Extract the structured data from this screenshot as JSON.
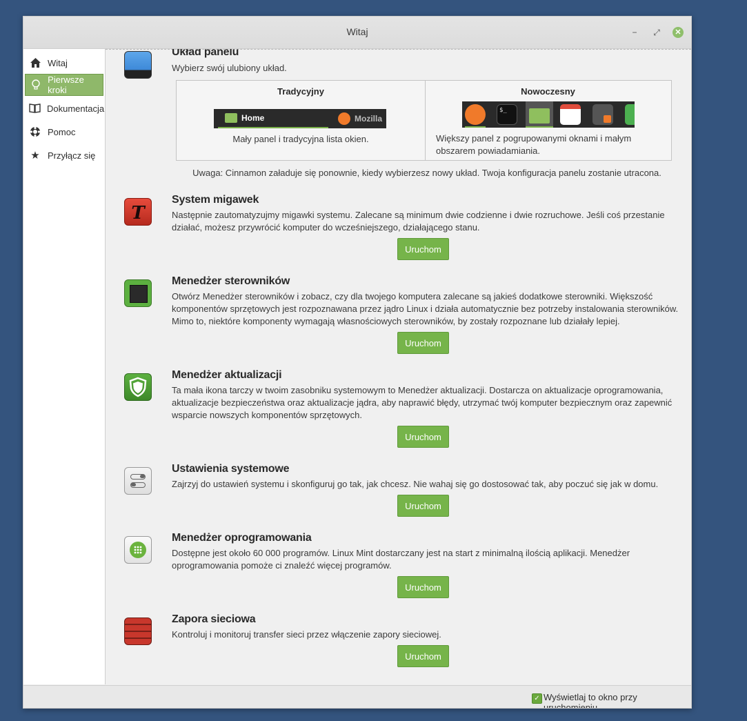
{
  "window": {
    "title": "Witaj"
  },
  "sidebar": {
    "items": [
      {
        "label": "Witaj",
        "icon": "home-icon"
      },
      {
        "label": "Pierwsze kroki",
        "icon": "lightbulb-icon"
      },
      {
        "label": "Dokumentacja",
        "icon": "book-icon"
      },
      {
        "label": "Pomoc",
        "icon": "lifebuoy-icon"
      },
      {
        "label": "Przyłącz się",
        "icon": "star-icon"
      }
    ],
    "active_index": 1
  },
  "panel_layout": {
    "title": "Układ panelu",
    "subtitle": "Wybierz swój ulubiony układ.",
    "traditional": {
      "title": "Tradycyjny",
      "description": "Mały panel i tradycyjna lista okien.",
      "preview_labels": [
        "Home",
        "Mozilla"
      ]
    },
    "modern": {
      "title": "Nowoczesny",
      "description": "Większy panel z pogrupowanymi oknami i małym obszarem powiadamiania."
    },
    "note": "Uwaga: Cinnamon załaduje się ponownie, kiedy wybierzesz nowy układ. Twoja konfiguracja panelu zostanie utracona."
  },
  "sections": [
    {
      "title": "System migawek",
      "description": "Następnie zautomatyzujmy migawki systemu. Zalecane są minimum dwie codzienne i dwie rozruchowe. Jeśli coś przestanie działać, możesz przywrócić komputer do wcześniejszego, działającego stanu.",
      "button": "Uruchom",
      "icon": "timeshift-icon"
    },
    {
      "title": "Menedżer sterowników",
      "description": "Otwórz Menedżer sterowników i zobacz, czy dla twojego komputera zalecane są jakieś dodatkowe sterowniki. Większość komponentów sprzętowych jest rozpoznawana przez jądro Linux i działa automatycznie bez potrzeby instalowania sterowników. Mimo to, niektóre komponenty wymagają własnościowych sterowników, by zostały rozpoznane lub działały lepiej.",
      "button": "Uruchom",
      "icon": "chip-icon"
    },
    {
      "title": "Menedżer aktualizacji",
      "description": "Ta mała ikona tarczy w twoim zasobniku systemowym to Menedżer aktualizacji. Dostarcza on aktualizacje oprogramowania, aktualizacje bezpieczeństwa oraz aktualizacje jądra, aby naprawić błędy, utrzymać twój komputer bezpiecznym oraz zapewnić wsparcie nowszych komponentów sprzętowych.",
      "button": "Uruchom",
      "icon": "shield-icon"
    },
    {
      "title": "Ustawienia systemowe",
      "description": "Zajrzyj do ustawień systemu i skonfiguruj go tak, jak chcesz. Nie wahaj się go dostosować tak, aby poczuć się jak w domu.",
      "button": "Uruchom",
      "icon": "toggles-icon"
    },
    {
      "title": "Menedżer oprogramowania",
      "description": "Dostępne jest około 60 000 programów. Linux Mint dostarczany jest na start z minimalną ilością aplikacji. Menedżer oprogramowania pomoże ci znaleźć więcej programów.",
      "button": "Uruchom",
      "icon": "app-grid-icon"
    },
    {
      "title": "Zapora sieciowa",
      "description": "Kontroluj i monitoruj transfer sieci przez włączenie zapory sieciowej.",
      "button": "Uruchom",
      "icon": "firewall-icon"
    }
  ],
  "footer": {
    "checkbox_label": "Wyświetlaj to okno przy uruchomieniu",
    "checked": true
  },
  "colors": {
    "accent": "#76b44a",
    "desktop": "#34547e",
    "active_sidebar": "#8fb86a"
  }
}
